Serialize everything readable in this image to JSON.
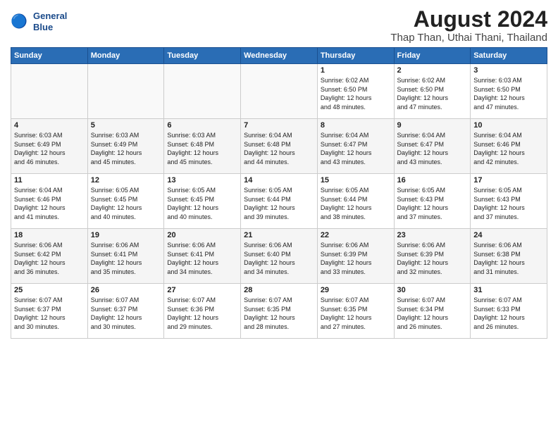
{
  "header": {
    "logo_line1": "General",
    "logo_line2": "Blue",
    "title": "August 2024",
    "subtitle": "Thap Than, Uthai Thani, Thailand"
  },
  "weekdays": [
    "Sunday",
    "Monday",
    "Tuesday",
    "Wednesday",
    "Thursday",
    "Friday",
    "Saturday"
  ],
  "weeks": [
    [
      {
        "day": "",
        "info": ""
      },
      {
        "day": "",
        "info": ""
      },
      {
        "day": "",
        "info": ""
      },
      {
        "day": "",
        "info": ""
      },
      {
        "day": "1",
        "info": "Sunrise: 6:02 AM\nSunset: 6:50 PM\nDaylight: 12 hours\nand 48 minutes."
      },
      {
        "day": "2",
        "info": "Sunrise: 6:02 AM\nSunset: 6:50 PM\nDaylight: 12 hours\nand 47 minutes."
      },
      {
        "day": "3",
        "info": "Sunrise: 6:03 AM\nSunset: 6:50 PM\nDaylight: 12 hours\nand 47 minutes."
      }
    ],
    [
      {
        "day": "4",
        "info": "Sunrise: 6:03 AM\nSunset: 6:49 PM\nDaylight: 12 hours\nand 46 minutes."
      },
      {
        "day": "5",
        "info": "Sunrise: 6:03 AM\nSunset: 6:49 PM\nDaylight: 12 hours\nand 45 minutes."
      },
      {
        "day": "6",
        "info": "Sunrise: 6:03 AM\nSunset: 6:48 PM\nDaylight: 12 hours\nand 45 minutes."
      },
      {
        "day": "7",
        "info": "Sunrise: 6:04 AM\nSunset: 6:48 PM\nDaylight: 12 hours\nand 44 minutes."
      },
      {
        "day": "8",
        "info": "Sunrise: 6:04 AM\nSunset: 6:47 PM\nDaylight: 12 hours\nand 43 minutes."
      },
      {
        "day": "9",
        "info": "Sunrise: 6:04 AM\nSunset: 6:47 PM\nDaylight: 12 hours\nand 43 minutes."
      },
      {
        "day": "10",
        "info": "Sunrise: 6:04 AM\nSunset: 6:46 PM\nDaylight: 12 hours\nand 42 minutes."
      }
    ],
    [
      {
        "day": "11",
        "info": "Sunrise: 6:04 AM\nSunset: 6:46 PM\nDaylight: 12 hours\nand 41 minutes."
      },
      {
        "day": "12",
        "info": "Sunrise: 6:05 AM\nSunset: 6:45 PM\nDaylight: 12 hours\nand 40 minutes."
      },
      {
        "day": "13",
        "info": "Sunrise: 6:05 AM\nSunset: 6:45 PM\nDaylight: 12 hours\nand 40 minutes."
      },
      {
        "day": "14",
        "info": "Sunrise: 6:05 AM\nSunset: 6:44 PM\nDaylight: 12 hours\nand 39 minutes."
      },
      {
        "day": "15",
        "info": "Sunrise: 6:05 AM\nSunset: 6:44 PM\nDaylight: 12 hours\nand 38 minutes."
      },
      {
        "day": "16",
        "info": "Sunrise: 6:05 AM\nSunset: 6:43 PM\nDaylight: 12 hours\nand 37 minutes."
      },
      {
        "day": "17",
        "info": "Sunrise: 6:05 AM\nSunset: 6:43 PM\nDaylight: 12 hours\nand 37 minutes."
      }
    ],
    [
      {
        "day": "18",
        "info": "Sunrise: 6:06 AM\nSunset: 6:42 PM\nDaylight: 12 hours\nand 36 minutes."
      },
      {
        "day": "19",
        "info": "Sunrise: 6:06 AM\nSunset: 6:41 PM\nDaylight: 12 hours\nand 35 minutes."
      },
      {
        "day": "20",
        "info": "Sunrise: 6:06 AM\nSunset: 6:41 PM\nDaylight: 12 hours\nand 34 minutes."
      },
      {
        "day": "21",
        "info": "Sunrise: 6:06 AM\nSunset: 6:40 PM\nDaylight: 12 hours\nand 34 minutes."
      },
      {
        "day": "22",
        "info": "Sunrise: 6:06 AM\nSunset: 6:39 PM\nDaylight: 12 hours\nand 33 minutes."
      },
      {
        "day": "23",
        "info": "Sunrise: 6:06 AM\nSunset: 6:39 PM\nDaylight: 12 hours\nand 32 minutes."
      },
      {
        "day": "24",
        "info": "Sunrise: 6:06 AM\nSunset: 6:38 PM\nDaylight: 12 hours\nand 31 minutes."
      }
    ],
    [
      {
        "day": "25",
        "info": "Sunrise: 6:07 AM\nSunset: 6:37 PM\nDaylight: 12 hours\nand 30 minutes."
      },
      {
        "day": "26",
        "info": "Sunrise: 6:07 AM\nSunset: 6:37 PM\nDaylight: 12 hours\nand 30 minutes."
      },
      {
        "day": "27",
        "info": "Sunrise: 6:07 AM\nSunset: 6:36 PM\nDaylight: 12 hours\nand 29 minutes."
      },
      {
        "day": "28",
        "info": "Sunrise: 6:07 AM\nSunset: 6:35 PM\nDaylight: 12 hours\nand 28 minutes."
      },
      {
        "day": "29",
        "info": "Sunrise: 6:07 AM\nSunset: 6:35 PM\nDaylight: 12 hours\nand 27 minutes."
      },
      {
        "day": "30",
        "info": "Sunrise: 6:07 AM\nSunset: 6:34 PM\nDaylight: 12 hours\nand 26 minutes."
      },
      {
        "day": "31",
        "info": "Sunrise: 6:07 AM\nSunset: 6:33 PM\nDaylight: 12 hours\nand 26 minutes."
      }
    ]
  ]
}
